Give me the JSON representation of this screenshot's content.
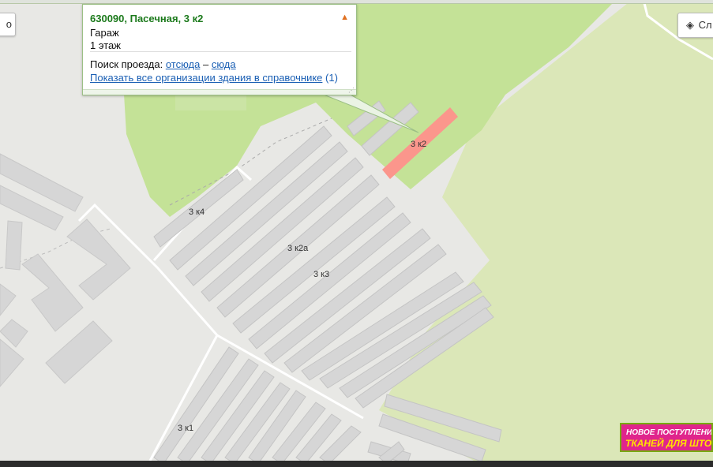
{
  "popup": {
    "address": "630090, Пасечная, 3 к2",
    "type": "Гараж",
    "floors": "1 этаж",
    "route_label": "Поиск проезда:",
    "route_from": "отсюда",
    "route_sep": "–",
    "route_to": "сюда",
    "show_orgs_link": "Показать все организации здания в справочнике",
    "orgs_count": "(1)"
  },
  "controls": {
    "left_button": "о",
    "layers_button": "Сл"
  },
  "building_labels": [
    "3 к2",
    "3 к4",
    "3 к2а",
    "3 к3",
    "3 к1"
  ],
  "ad": {
    "line1": "НОВОЕ ПОСТУПЛЕНИЕ",
    "line2": "ТКАНЕЙ ДЛЯ ШТОР"
  },
  "colors": {
    "park": "#c4e297",
    "park_light": "#dbe7b8",
    "ground": "#e8e8e5",
    "block": "#d6d6d6",
    "selected_building": "#fb968c",
    "road": "#ffffff"
  }
}
